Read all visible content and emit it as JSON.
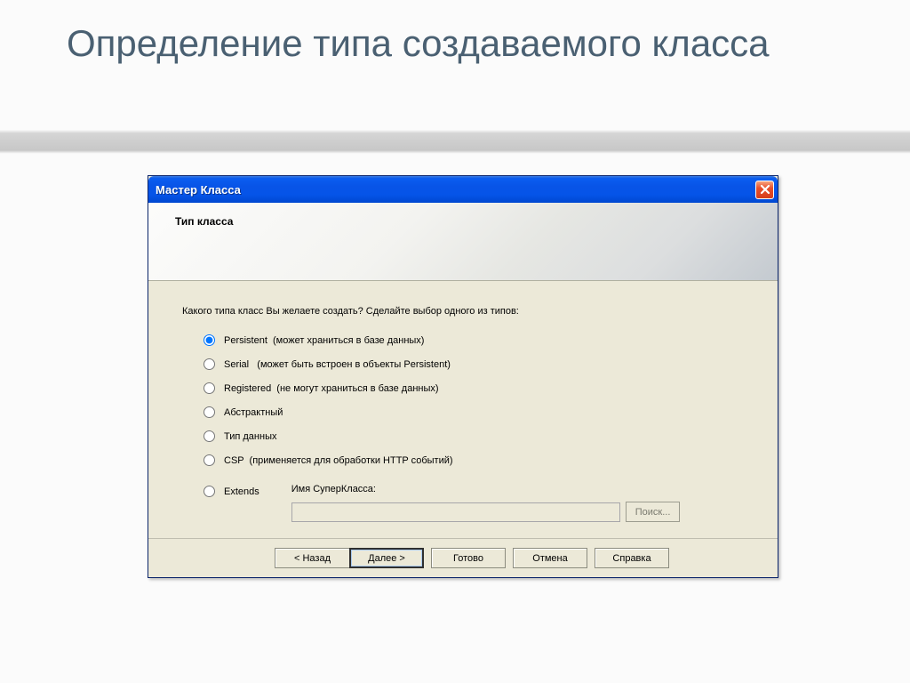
{
  "slide": {
    "title": "Определение типа создаваемого класса"
  },
  "dialog": {
    "title": "Мастер Класса",
    "headerTitle": "Тип класса",
    "prompt": "Какого типа класс Вы желаете создать? Сделайте выбор одного из типов:",
    "options": [
      {
        "label": "Persistent  (может храниться в базе данных)",
        "selected": true
      },
      {
        "label": "Serial   (может быть встроен в объекты Persistent)",
        "selected": false
      },
      {
        "label": "Registered  (не могут храниться в базе данных)",
        "selected": false
      },
      {
        "label": "Абстрактный",
        "selected": false
      },
      {
        "label": "Тип данных",
        "selected": false
      },
      {
        "label": "CSP  (применяется для обработки HTTP событий)",
        "selected": false
      }
    ],
    "extends": {
      "label": "Extends",
      "superclassLabel": "Имя СуперКласса:",
      "superclassValue": "",
      "searchButton": "Поиск..."
    },
    "buttons": {
      "back": "< Назад",
      "next": "Далее >",
      "finish": "Готово",
      "cancel": "Отмена",
      "help": "Справка"
    }
  }
}
